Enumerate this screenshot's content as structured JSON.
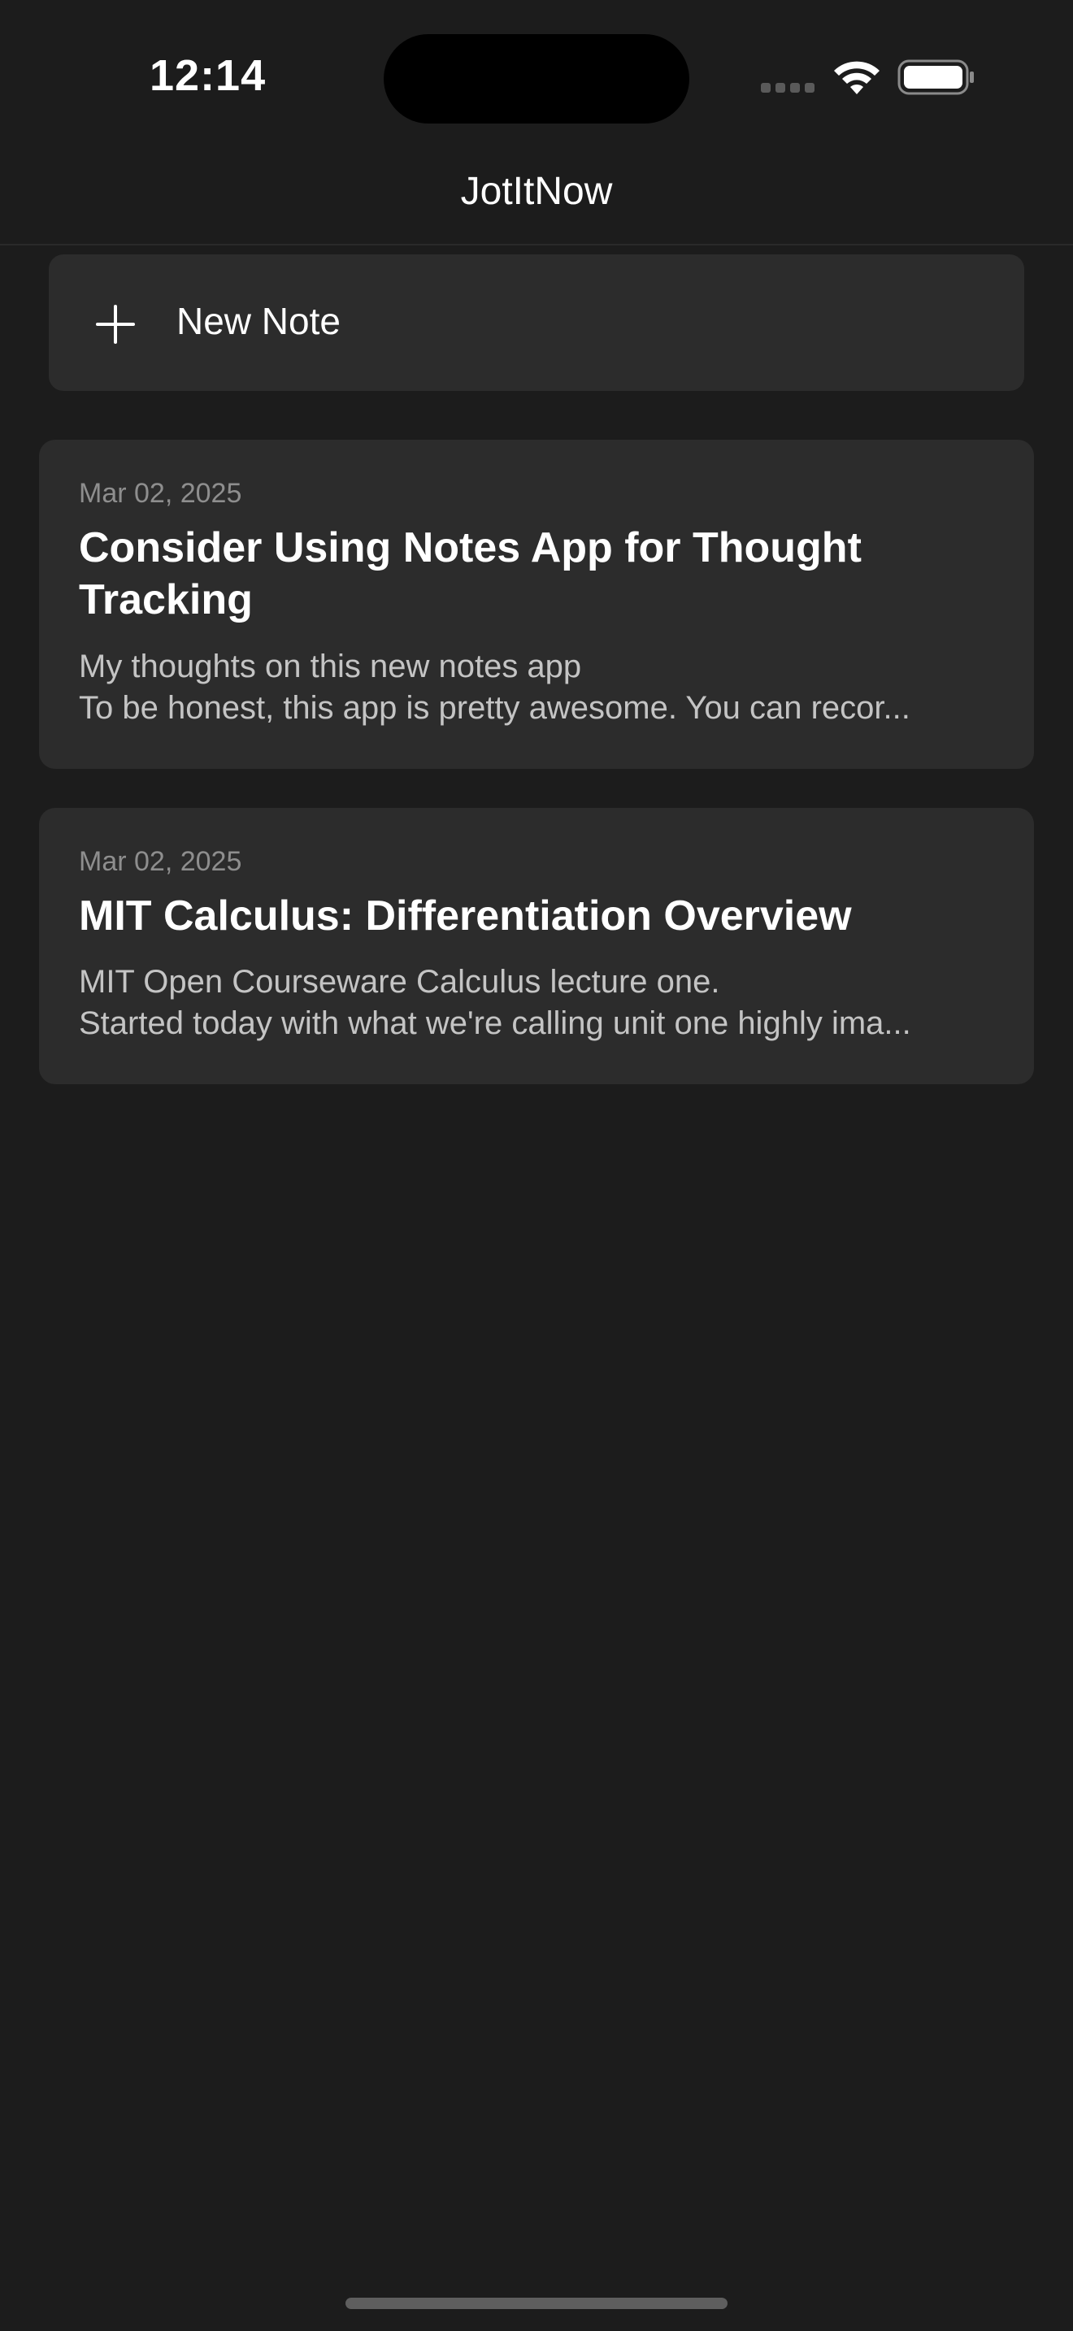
{
  "status_bar": {
    "time": "12:14",
    "icons": [
      "signal-dots-icon",
      "wifi-icon",
      "battery-icon"
    ]
  },
  "nav": {
    "title": "JotItNow"
  },
  "new_note": {
    "icon": "plus-icon",
    "label": "New Note"
  },
  "notes": [
    {
      "date": "Mar 02, 2025",
      "title": "Consider Using Notes App for Thought Tracking",
      "preview_line1": "My thoughts on this new notes app",
      "preview_line2": "To be honest, this app is pretty awesome. You can recor..."
    },
    {
      "date": "Mar 02, 2025",
      "title": "MIT Calculus: Differentiation Overview",
      "preview_line1": "MIT Open Courseware Calculus lecture one.",
      "preview_line2": "Started today with what we're calling unit one highly ima..."
    }
  ],
  "colors": {
    "background": "#1c1c1c",
    "card": "#2c2c2c",
    "text_primary": "#ffffff",
    "text_secondary": "#c4c4c4",
    "text_muted": "#8e8e8e"
  }
}
